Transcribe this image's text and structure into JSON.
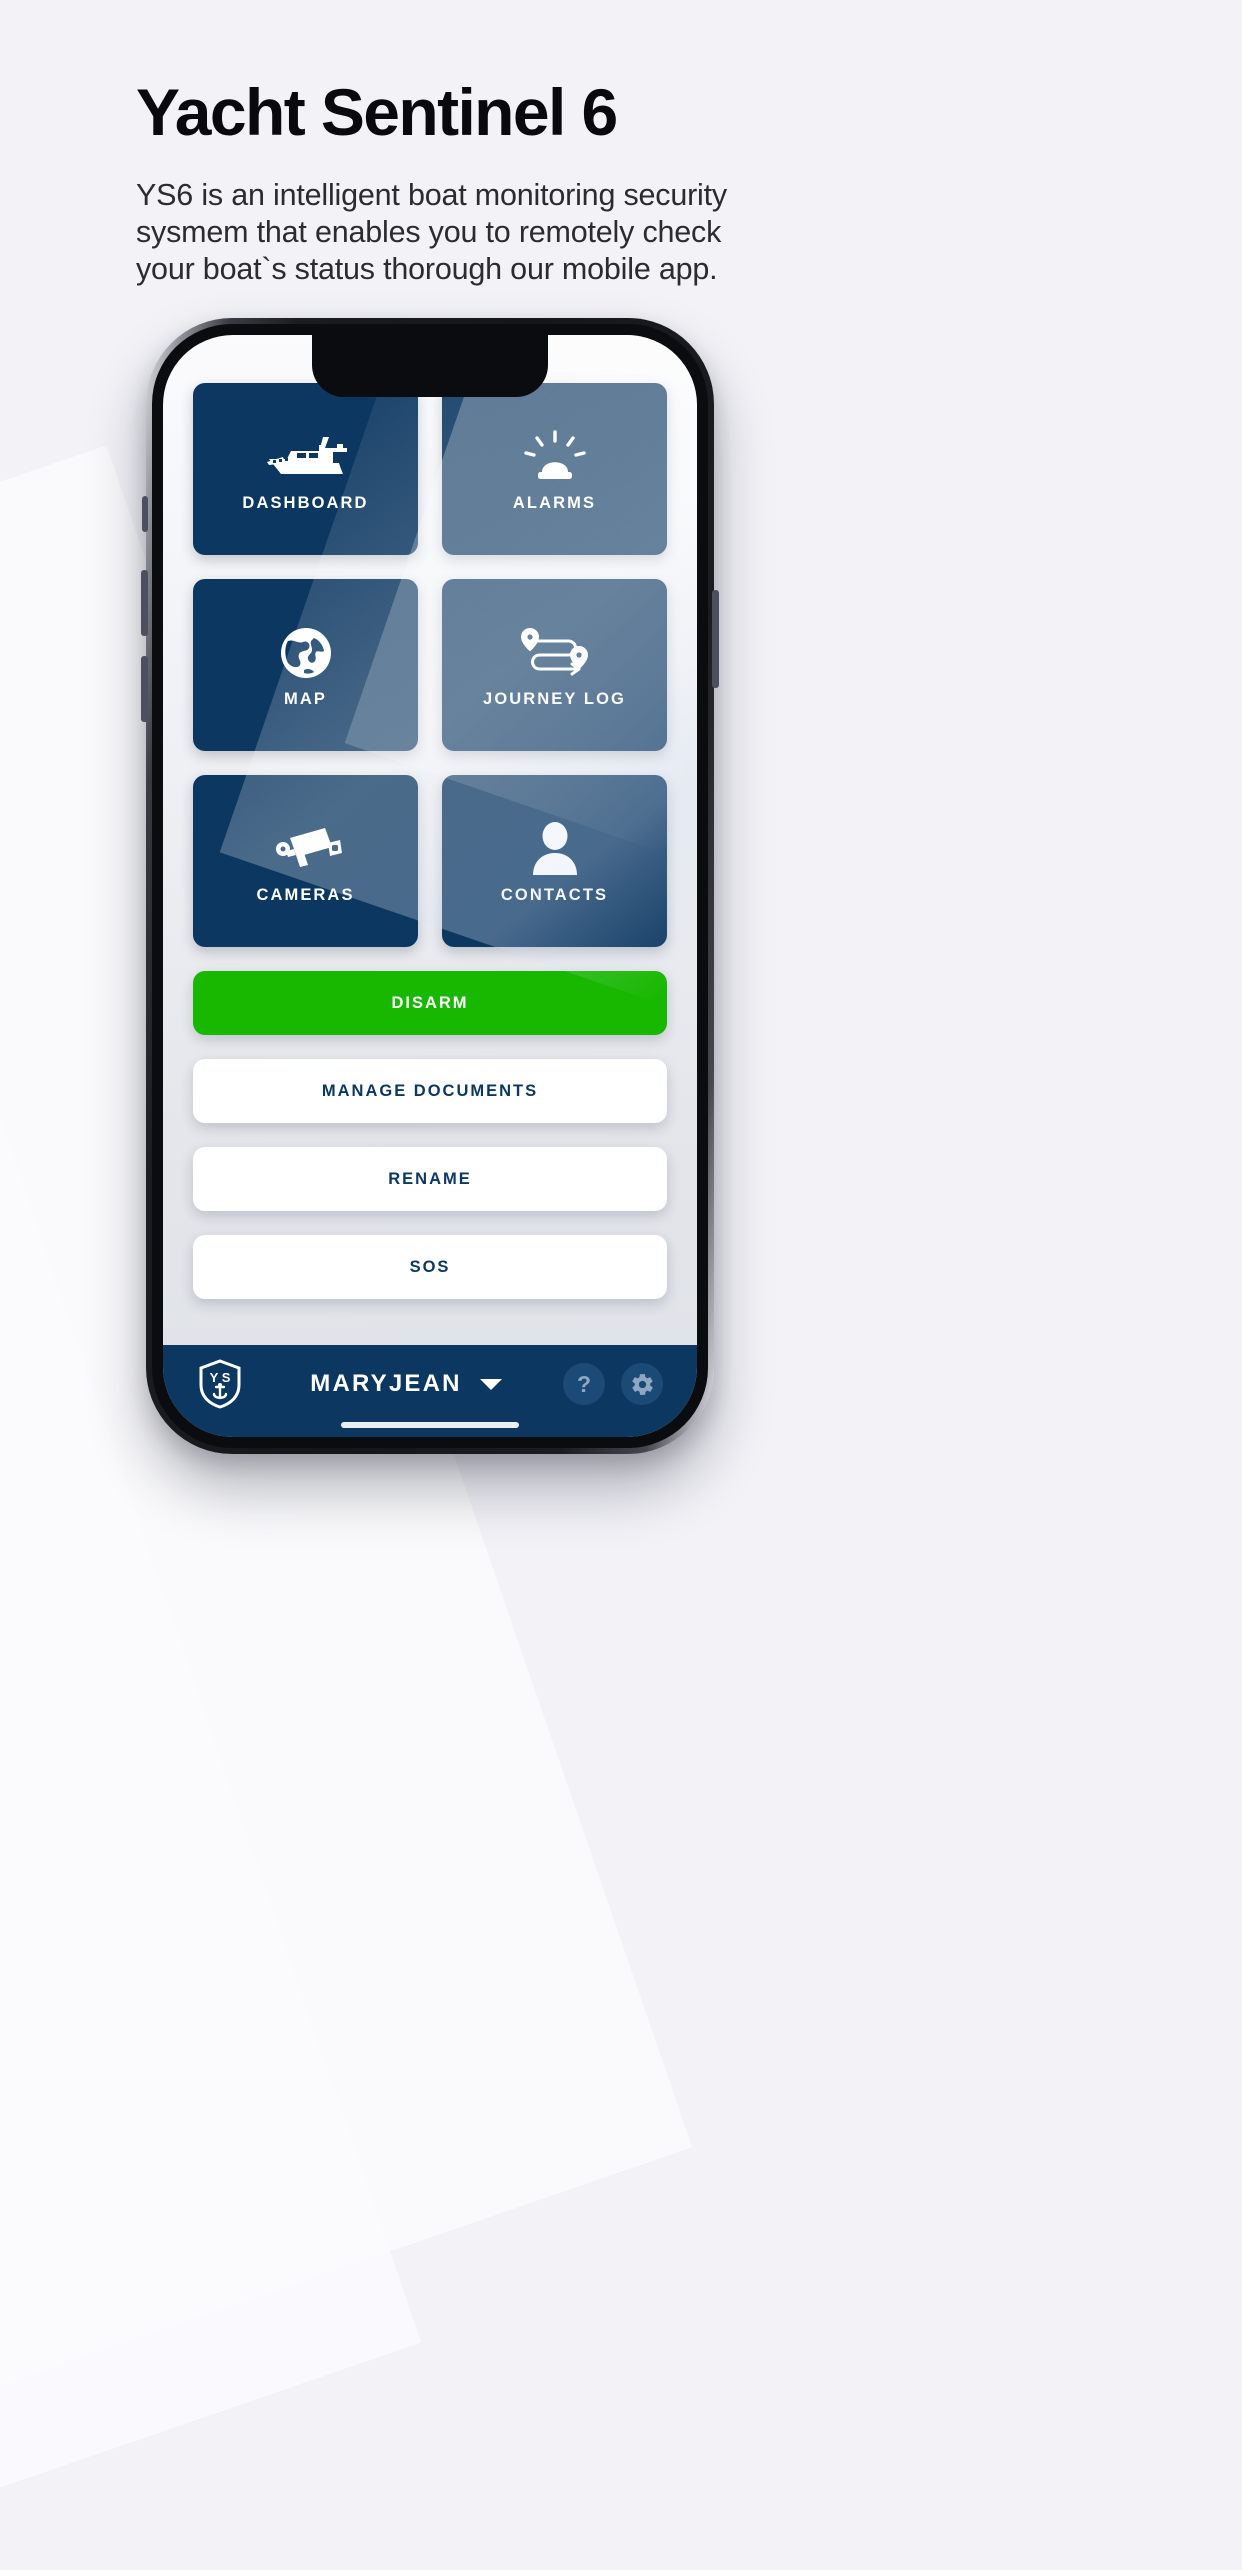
{
  "header": {
    "title": "Yacht Sentinel 6",
    "description": "YS6 is an intelligent boat monitoring security sysmem that enables you to remotely check your boat`s status thorough our mobile app."
  },
  "colors": {
    "page_bg": "#f2f2f7",
    "tile_navy": "#0c3761",
    "disarm_green": "#18b800",
    "white_button_text": "#0c3761"
  },
  "phone": {
    "app": {
      "tiles": [
        {
          "label": "DASHBOARD",
          "icon": "boat-icon"
        },
        {
          "label": "ALARMS",
          "icon": "alarm-beacon-icon"
        },
        {
          "label": "MAP",
          "icon": "globe-icon"
        },
        {
          "label": "JOURNEY LOG",
          "icon": "route-icon"
        },
        {
          "label": "CAMERAS",
          "icon": "cctv-camera-icon"
        },
        {
          "label": "CONTACTS",
          "icon": "person-icon"
        }
      ],
      "actions": [
        {
          "label": "DISARM",
          "style": "green"
        },
        {
          "label": "MANAGE DOCUMENTS",
          "style": "white"
        },
        {
          "label": "RENAME",
          "style": "white"
        },
        {
          "label": "SOS",
          "style": "white"
        }
      ],
      "navbar": {
        "logo_text": "Y S",
        "boat_name": "MARYJEAN",
        "help_icon": "?",
        "settings_icon": "gear-icon"
      }
    }
  }
}
